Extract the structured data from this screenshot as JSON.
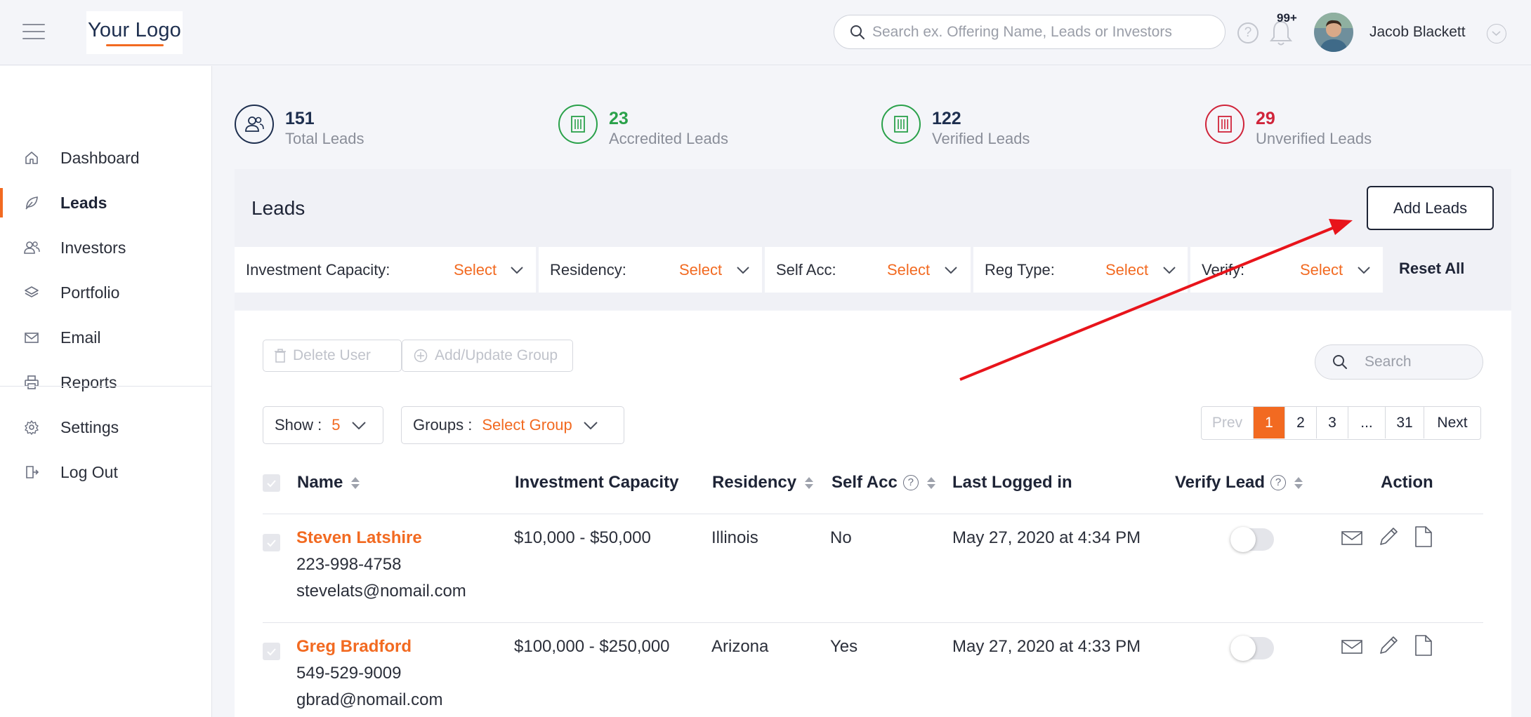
{
  "header": {
    "logo_text": "Your Logo",
    "search_placeholder": "Search ex. Offering Name, Leads or Investors",
    "help_icon": "question-circle-icon",
    "notification_badge": "99+",
    "user_name": "Jacob Blackett"
  },
  "sidebar": {
    "items": [
      {
        "label": "Dashboard",
        "icon": "home-icon"
      },
      {
        "label": "Leads",
        "icon": "leaf-icon",
        "active": true
      },
      {
        "label": "Investors",
        "icon": "users-icon"
      },
      {
        "label": "Portfolio",
        "icon": "layers-icon"
      },
      {
        "label": "Email",
        "icon": "envelope-icon"
      },
      {
        "label": "Reports",
        "icon": "printer-icon"
      }
    ],
    "bottom_items": [
      {
        "label": "Settings",
        "icon": "gear-icon"
      },
      {
        "label": "Log Out",
        "icon": "logout-icon"
      }
    ]
  },
  "stats": [
    {
      "count": "151",
      "label": "Total Leads",
      "color": "#1e2f4f"
    },
    {
      "count": "23",
      "label": "Accredited Leads",
      "color": "#2aa14a"
    },
    {
      "count": "122",
      "label": "Verified Leads",
      "color": "#1e2f4f"
    },
    {
      "count": "29",
      "label": "Unverified Leads",
      "color": "#d0243a"
    }
  ],
  "leads_panel": {
    "title": "Leads",
    "add_button": "Add Leads",
    "filters": [
      {
        "label": "Investment Capacity:",
        "value": "Select"
      },
      {
        "label": "Residency:",
        "value": "Select"
      },
      {
        "label": "Self Acc:",
        "value": "Select"
      },
      {
        "label": "Reg Type:",
        "value": "Select"
      },
      {
        "label": "Verify:",
        "value": "Select"
      }
    ],
    "reset_all": "Reset All"
  },
  "table": {
    "delete_user": "Delete User",
    "add_update_group": "Add/Update Group",
    "search_placeholder": "Search",
    "show_label": "Show :",
    "show_value": "5",
    "groups_label": "Groups :",
    "groups_value": "Select Group",
    "pagination": {
      "prev": "Prev",
      "pages": [
        "1",
        "2",
        "3",
        "...",
        "31"
      ],
      "current": "1",
      "next": "Next"
    },
    "columns": {
      "name": "Name",
      "investment_capacity": "Investment Capacity",
      "residency": "Residency",
      "self_acc": "Self Acc",
      "last_logged_in": "Last Logged in",
      "verify_lead": "Verify Lead",
      "action": "Action"
    },
    "rows": [
      {
        "name": "Steven Latshire",
        "phone": "223-998-4758",
        "email": "stevelats@nomail.com",
        "investment_capacity": "$10,000 - $50,000",
        "residency": "Illinois",
        "self_acc": "No",
        "last_logged_in": "May 27, 2020 at 4:34 PM",
        "verified": false
      },
      {
        "name": "Greg Bradford",
        "phone": "549-529-9009",
        "email": "gbrad@nomail.com",
        "investment_capacity": "$100,000 - $250,000",
        "residency": "Arizona",
        "self_acc": "Yes",
        "last_logged_in": "May 27, 2020 at 4:33 PM",
        "verified": false
      }
    ]
  },
  "annotation": {
    "arrow_color": "#e8141b"
  }
}
